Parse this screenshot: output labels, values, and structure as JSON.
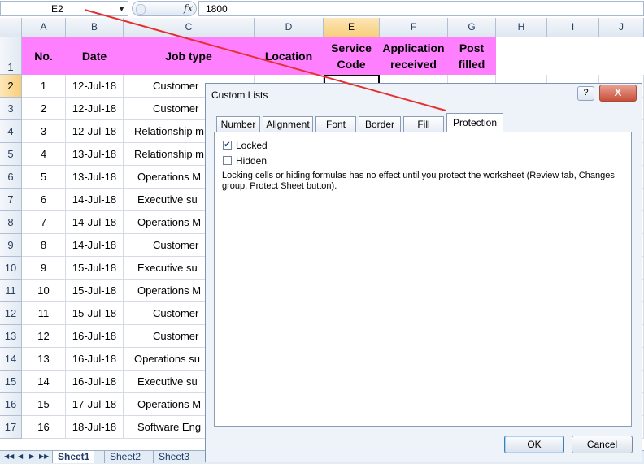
{
  "formula_bar": {
    "name_box": "E2",
    "fx": "fx",
    "value": "1800"
  },
  "columns": [
    "A",
    "B",
    "C",
    "D",
    "E",
    "F",
    "G",
    "H",
    "I",
    "J"
  ],
  "selected_column": "E",
  "header_row": {
    "row": "1",
    "cells": [
      "No.",
      "Date",
      "Job type",
      "Location",
      "Service Code",
      "Application received",
      "Post filled"
    ]
  },
  "rows": [
    {
      "n": "2",
      "a": "1",
      "b": "12-Jul-18",
      "c": "Customer"
    },
    {
      "n": "3",
      "a": "2",
      "b": "12-Jul-18",
      "c": "Customer"
    },
    {
      "n": "4",
      "a": "3",
      "b": "12-Jul-18",
      "c": "Relationship m"
    },
    {
      "n": "5",
      "a": "4",
      "b": "13-Jul-18",
      "c": "Relationship m"
    },
    {
      "n": "6",
      "a": "5",
      "b": "13-Jul-18",
      "c": "Operations M"
    },
    {
      "n": "7",
      "a": "6",
      "b": "14-Jul-18",
      "c": "Executive su"
    },
    {
      "n": "8",
      "a": "7",
      "b": "14-Jul-18",
      "c": "Operations M"
    },
    {
      "n": "9",
      "a": "8",
      "b": "14-Jul-18",
      "c": "Customer"
    },
    {
      "n": "10",
      "a": "9",
      "b": "15-Jul-18",
      "c": "Executive su"
    },
    {
      "n": "11",
      "a": "10",
      "b": "15-Jul-18",
      "c": "Operations M"
    },
    {
      "n": "12",
      "a": "11",
      "b": "15-Jul-18",
      "c": "Customer"
    },
    {
      "n": "13",
      "a": "12",
      "b": "16-Jul-18",
      "c": "Customer"
    },
    {
      "n": "14",
      "a": "13",
      "b": "16-Jul-18",
      "c": "Operations su"
    },
    {
      "n": "15",
      "a": "14",
      "b": "16-Jul-18",
      "c": "Executive su"
    },
    {
      "n": "16",
      "a": "15",
      "b": "17-Jul-18",
      "c": "Operations M"
    },
    {
      "n": "17",
      "a": "16",
      "b": "18-Jul-18",
      "c": "Software Eng"
    }
  ],
  "sheet_tabs": [
    "Sheet1",
    "Sheet2",
    "Sheet3"
  ],
  "active_sheet": "Sheet1",
  "dialog": {
    "title": "Custom Lists",
    "help": "?",
    "close": "X",
    "tabs": [
      "Number",
      "Alignment",
      "Font",
      "Border",
      "Fill",
      "Protection"
    ],
    "active_tab": "Protection",
    "locked_label": "Locked",
    "locked_checked": true,
    "hidden_label": "Hidden",
    "hidden_checked": false,
    "note": "Locking cells or hiding formulas has no effect until you protect the worksheet (Review tab, Changes group, Protect Sheet button).",
    "ok": "OK",
    "cancel": "Cancel"
  },
  "colors": {
    "header_fill": "#ff80ff",
    "annotation_arrow": "#e53030",
    "selection": "#f7cf7a"
  }
}
